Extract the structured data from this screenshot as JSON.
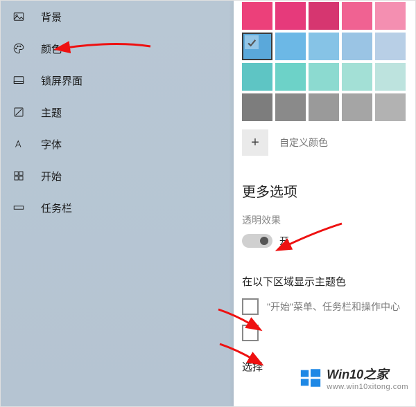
{
  "sidebar": {
    "items": [
      {
        "label": "背景",
        "name": "nav-background"
      },
      {
        "label": "颜色",
        "name": "nav-colors"
      },
      {
        "label": "锁屏界面",
        "name": "nav-lockscreen"
      },
      {
        "label": "主题",
        "name": "nav-themes"
      },
      {
        "label": "字体",
        "name": "nav-fonts"
      },
      {
        "label": "开始",
        "name": "nav-start"
      },
      {
        "label": "任务栏",
        "name": "nav-taskbar"
      }
    ]
  },
  "colors": {
    "grid": [
      [
        "#ec407a",
        "#e63a7b",
        "#d63670",
        "#f06292",
        "#f48fb1"
      ],
      [
        "#5aa8da",
        "#6cb8e6",
        "#86c3e6",
        "#9ac4e4",
        "#b8cfe6"
      ],
      [
        "#5ec5c4",
        "#6dd2c8",
        "#8cdad0",
        "#a3e0d6",
        "#bde3de"
      ],
      [
        "#7d7d7d",
        "#8a8a8a",
        "#9a9a9a",
        "#a5a5a5",
        "#b2b2b2"
      ]
    ],
    "selected": {
      "row": 1,
      "col": 0
    },
    "custom_label": "自定义颜色"
  },
  "more": {
    "title": "更多选项",
    "transparency_label": "透明效果",
    "toggle_state": "开"
  },
  "accent": {
    "title": "在以下区域显示主题色",
    "option1": "\"开始\"菜单、任务栏和操作中心",
    "option2": "",
    "select_label": "选择"
  },
  "watermark": {
    "line1": "Win10之家",
    "line2": "www.win10xitong.com"
  }
}
